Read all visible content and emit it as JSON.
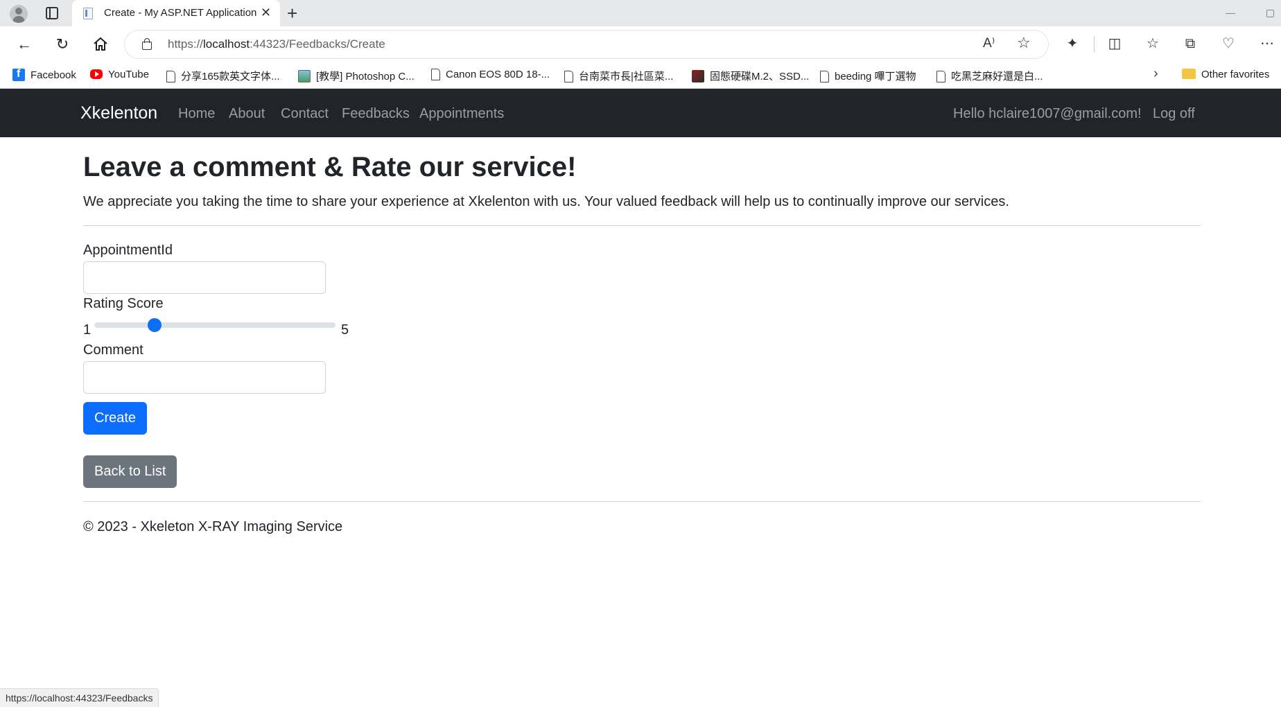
{
  "browser": {
    "tab_title": "Create - My ASP.NET Application",
    "tab_close": "✕",
    "new_tab": "+",
    "url_scheme": "https://",
    "url_host": "localhost",
    "url_rest": ":44323/Feedbacks/Create",
    "read_aloud": "Ȧ̧",
    "bookmarks": [
      {
        "label": "Facebook",
        "icon": "facebook-icon"
      },
      {
        "label": "YouTube",
        "icon": "youtube-icon"
      },
      {
        "label": "分享165款英文字体...",
        "icon": "page-icon"
      },
      {
        "label": "[教學] Photoshop C...",
        "icon": "image-icon"
      },
      {
        "label": "Canon EOS 80D 18-...",
        "icon": "page-icon"
      },
      {
        "label": "台南菜市長|社區菜...",
        "icon": "page-icon"
      },
      {
        "label": "固態硬碟M.2、SSD...",
        "icon": "site-icon"
      },
      {
        "label": "beeding 嗶丁選物",
        "icon": "page-icon"
      },
      {
        "label": "吃黑芝麻好還是白...",
        "icon": "page-icon"
      }
    ],
    "other_favorites": "Other favorites",
    "status_url": "https://localhost:44323/Feedbacks"
  },
  "navbar": {
    "brand": "Xkelenton",
    "links": [
      "Home",
      "About",
      "Contact",
      "Feedbacks",
      "Appointments"
    ],
    "greeting": "Hello hclaire1007@gmail.com!",
    "logoff": "Log off"
  },
  "page": {
    "title": "Leave a comment & Rate our service!",
    "intro": "We appreciate you taking the time to share your experience at Xkelenton with us. Your valued feedback will help us to continually improve our services.",
    "form": {
      "appointment_label": "AppointmentId",
      "appointment_value": "",
      "rating_label": "Rating Score",
      "rating_min": "1",
      "rating_max": "5",
      "rating_value": 2,
      "comment_label": "Comment",
      "comment_value": "",
      "create_button": "Create"
    },
    "back_link": "Back to List",
    "footer": "© 2023 - Xkeleton X-RAY Imaging Service"
  },
  "colors": {
    "navbar_bg": "#212529",
    "primary": "#0d6efd",
    "secondary": "#6c757d"
  }
}
